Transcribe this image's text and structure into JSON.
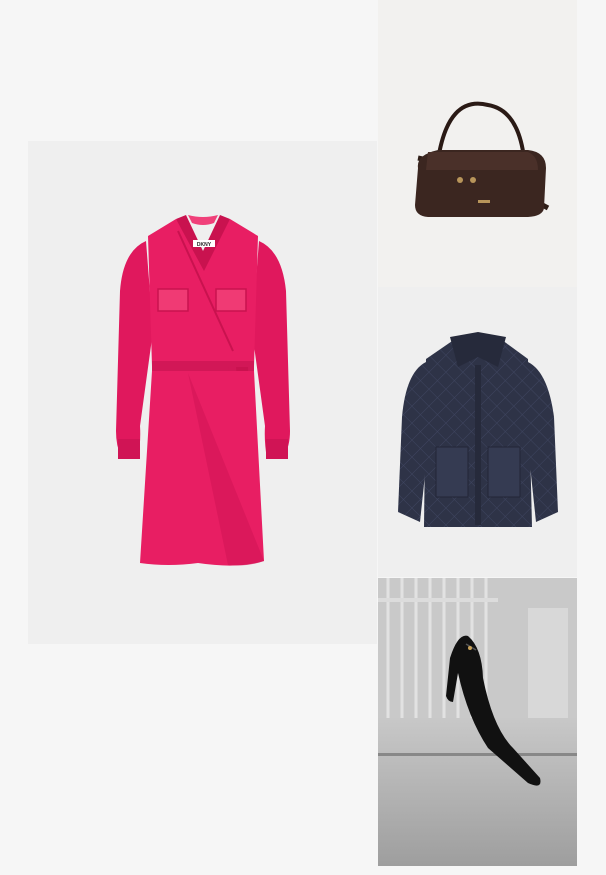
{
  "products": [
    {
      "id": "dress",
      "kind": "wrap-dress-image",
      "label_text": "DKNY",
      "color": "#e81e63"
    },
    {
      "id": "bag",
      "kind": "handbag-image",
      "color": "#3b2620"
    },
    {
      "id": "jacket",
      "kind": "quilted-jacket-image",
      "color": "#2e3347"
    },
    {
      "id": "shoe",
      "kind": "pump-heel-image",
      "color": "#111111"
    }
  ]
}
